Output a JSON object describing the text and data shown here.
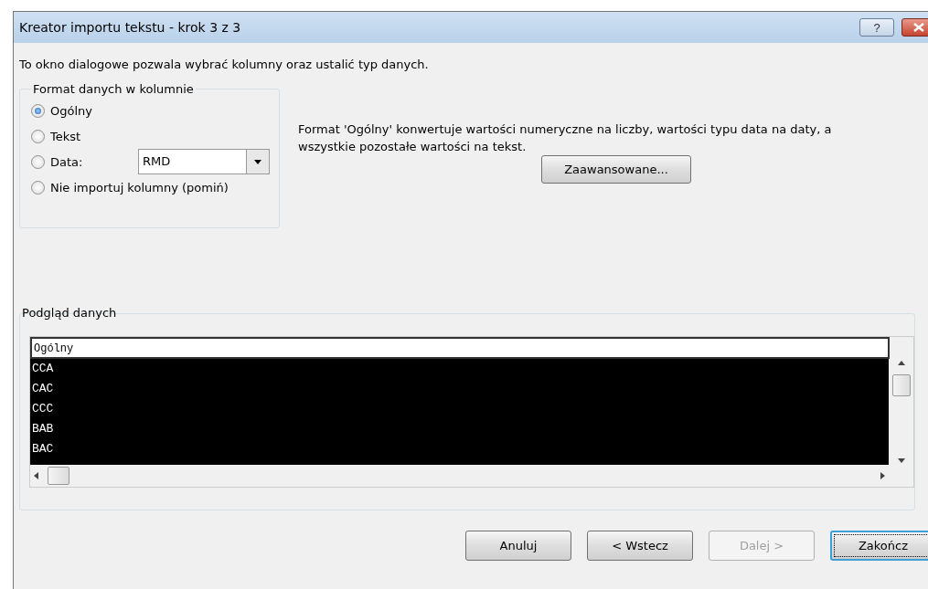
{
  "window": {
    "title": "Kreator importu tekstu - krok 3 z 3",
    "help": "?"
  },
  "intro": "To okno dialogowe pozwala wybrać kolumny oraz ustalić typ danych.",
  "format_group": {
    "title": "Format danych w kolumnie",
    "options": [
      {
        "kind": "plain",
        "label": "Ogólny",
        "selected": true
      },
      {
        "kind": "plain",
        "label": "Tekst",
        "selected": false
      },
      {
        "kind": "date",
        "label": "Data:",
        "selected": false,
        "dropdown": "RMD"
      },
      {
        "kind": "plain",
        "label": "Nie importuj kolumny (pomiń)",
        "selected": false
      }
    ]
  },
  "format_info": "Format 'Ogólny' konwertuje wartości numeryczne na liczby, wartości typu data na daty, a\nwszystkie pozostałe wartości na tekst.",
  "advanced_button": "Zaawansowane...",
  "preview": {
    "title": "Podgląd danych",
    "columns": [
      {
        "header": "Ogólny",
        "selected": true,
        "cells": [
          "CCA",
          "CAC",
          "CCC",
          "BAB",
          "BAC"
        ]
      }
    ]
  },
  "buttons": [
    {
      "label": "Anuluj",
      "disabled": false,
      "default": false
    },
    {
      "label": "< Wstecz",
      "disabled": false,
      "default": false
    },
    {
      "label": "Dalej >",
      "disabled": true,
      "default": false
    },
    {
      "label": "Zakończ",
      "disabled": false,
      "default": true
    }
  ]
}
